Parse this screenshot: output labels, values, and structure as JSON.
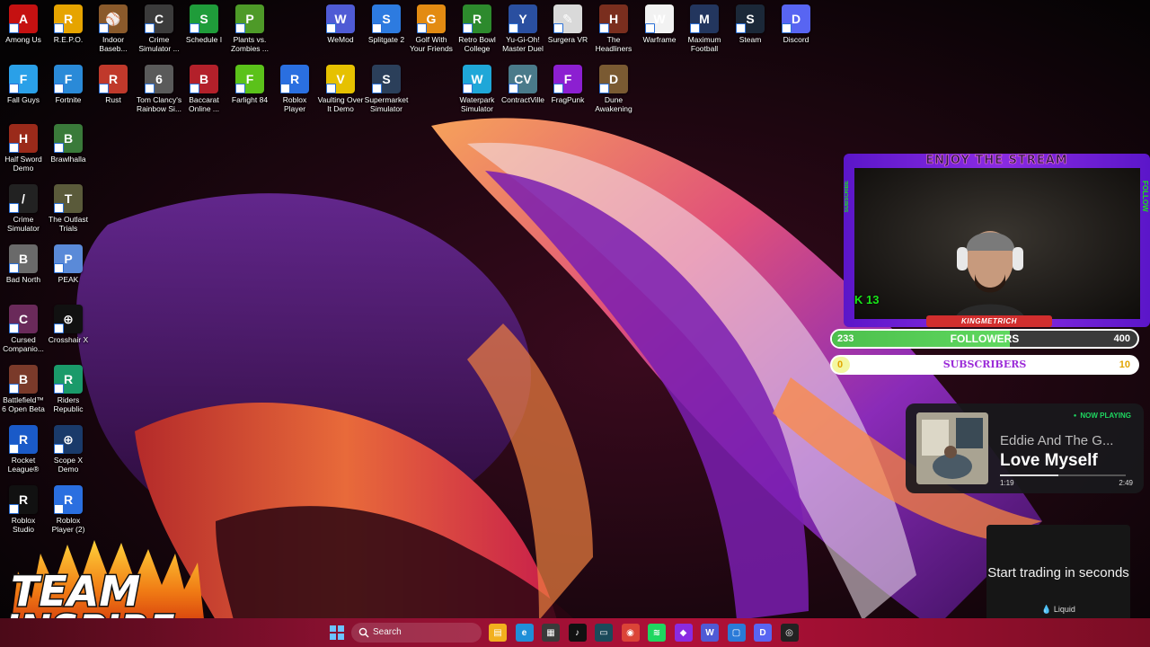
{
  "desktop": {
    "icons_top": [
      {
        "label": "Among Us",
        "icon": "among-us-icon",
        "color": "#c51111",
        "glyph": "A"
      },
      {
        "label": "R.E.P.O.",
        "icon": "repo-icon",
        "color": "#e6a400",
        "glyph": "R"
      },
      {
        "label": "Indoor Baseb...",
        "icon": "baseball-icon",
        "color": "#8a5a2b",
        "glyph": "⚾"
      },
      {
        "label": "Crime Simulator ...",
        "icon": "crime-sim-icon",
        "color": "#3b3b3b",
        "glyph": "C"
      },
      {
        "label": "Schedule I",
        "icon": "schedule-icon",
        "color": "#1f9c3a",
        "glyph": "S"
      },
      {
        "label": "Plants vs. Zombies ...",
        "icon": "pvz-icon",
        "color": "#4e9a28",
        "glyph": "P"
      },
      {
        "label": "WeMod",
        "icon": "wemod-icon",
        "color": "#4f5bd5",
        "glyph": "W"
      },
      {
        "label": "Splitgate 2",
        "icon": "splitgate-icon",
        "color": "#2d7be0",
        "glyph": "S"
      },
      {
        "label": "Golf With Your Friends",
        "icon": "golf-icon",
        "color": "#e38b12",
        "glyph": "G"
      },
      {
        "label": "Retro Bowl College",
        "icon": "retro-bowl-icon",
        "color": "#2d8a2d",
        "glyph": "R"
      },
      {
        "label": "Yu-Gi-Oh! Master Duel",
        "icon": "yugioh-icon",
        "color": "#2a4fa0",
        "glyph": "Y"
      },
      {
        "label": "Surgera VR",
        "icon": "surgeon-icon",
        "color": "#d9d9d9",
        "glyph": "✎"
      },
      {
        "label": "The Headliners",
        "icon": "headliners-icon",
        "color": "#7a2e1e",
        "glyph": "H"
      },
      {
        "label": "Warframe",
        "icon": "warframe-icon",
        "color": "#f2f2f2",
        "glyph": "W"
      },
      {
        "label": "Maximum Football",
        "icon": "football-icon",
        "color": "#23365e",
        "glyph": "M"
      },
      {
        "label": "Steam",
        "icon": "steam-icon",
        "color": "#1b2838",
        "glyph": "S"
      },
      {
        "label": "Discord",
        "icon": "discord-icon",
        "color": "#5865f2",
        "glyph": "D"
      }
    ],
    "icons_row2": [
      {
        "label": "Fall Guys",
        "icon": "fall-guys-icon",
        "color": "#2aa0e8",
        "glyph": "F"
      },
      {
        "label": "Fortnite",
        "icon": "fortnite-icon",
        "color": "#2a8ad8",
        "glyph": "F"
      },
      {
        "label": "Rust",
        "icon": "rust-icon",
        "color": "#c0392b",
        "glyph": "R"
      },
      {
        "label": "Tom Clancy's Rainbow Si...",
        "icon": "rainbow-six-icon",
        "color": "#5a5a5a",
        "glyph": "6"
      },
      {
        "label": "Baccarat Online ...",
        "icon": "baccarat-icon",
        "color": "#b3202a",
        "glyph": "B"
      },
      {
        "label": "Farlight 84",
        "icon": "farlight-icon",
        "color": "#5bc21a",
        "glyph": "F"
      },
      {
        "label": "Roblox Player",
        "icon": "roblox-icon",
        "color": "#2a6fe0",
        "glyph": "R"
      },
      {
        "label": "Vaulting Over It Demo",
        "icon": "vaulting-icon",
        "color": "#e6c100",
        "glyph": "V"
      },
      {
        "label": "Supermarket Simulator",
        "icon": "supermarket-icon",
        "color": "#2b3f5a",
        "glyph": "S"
      },
      {
        "label": "Waterpark Simulator",
        "icon": "waterpark-icon",
        "color": "#1fa7d8",
        "glyph": "W"
      },
      {
        "label": "ContractVille",
        "icon": "contractville-icon",
        "color": "#4a7a8a",
        "glyph": "CV"
      },
      {
        "label": "FragPunk",
        "icon": "fragpunk-icon",
        "color": "#8c1fd1",
        "glyph": "F"
      },
      {
        "label": "Dune Awakening",
        "icon": "dune-icon",
        "color": "#7a5a32",
        "glyph": "D"
      }
    ],
    "icons_left": [
      {
        "label": "Half Sword Demo",
        "icon": "half-sword-icon",
        "color": "#9a2a1a",
        "glyph": "H"
      },
      {
        "label": "Brawlhalla",
        "icon": "brawlhalla-icon",
        "color": "#3a7a3a",
        "glyph": "B"
      },
      {
        "label": "Crime Simulator",
        "icon": "crime-sim-2-icon",
        "color": "#222222",
        "glyph": "/"
      },
      {
        "label": "The Outlast Trials",
        "icon": "outlast-icon",
        "color": "#5a5a3a",
        "glyph": "T"
      },
      {
        "label": "Bad North",
        "icon": "bad-north-icon",
        "color": "#6a6a6a",
        "glyph": "B"
      },
      {
        "label": "PEAK",
        "icon": "peak-icon",
        "color": "#5a8ad8",
        "glyph": "P"
      },
      {
        "label": "Cursed Companio...",
        "icon": "cursed-icon",
        "color": "#6a2a5a",
        "glyph": "C"
      },
      {
        "label": "Crosshair X",
        "icon": "crosshair-icon",
        "color": "#111111",
        "glyph": "⊕"
      },
      {
        "label": "Battlefield™ 6 Open Beta",
        "icon": "battlefield-icon",
        "color": "#7a3a2a",
        "glyph": "B"
      },
      {
        "label": "Riders Republic",
        "icon": "riders-icon",
        "color": "#1a9a6a",
        "glyph": "R"
      },
      {
        "label": "Rocket League®",
        "icon": "rocket-league-icon",
        "color": "#1a5ac8",
        "glyph": "R"
      },
      {
        "label": "Scope X Demo",
        "icon": "scope-icon",
        "color": "#1a3a6a",
        "glyph": "⊕"
      },
      {
        "label": "Roblox Studio",
        "icon": "roblox-studio-icon",
        "color": "#111111",
        "glyph": "R"
      },
      {
        "label": "Roblox Player (2)",
        "icon": "roblox-2-icon",
        "color": "#2a6fe0",
        "glyph": "R"
      }
    ]
  },
  "cam": {
    "title": "ENJOY THE STREAM",
    "name": "KINGMETRICH",
    "k_label": "K 13",
    "side_left": "SUBSCRIBE",
    "side_right": "FOLLOW"
  },
  "goals": {
    "followers": {
      "current": "233",
      "label": "FOLLOWERS",
      "target": "400",
      "progress": 0.5825
    },
    "subscribers": {
      "current": "0",
      "label": "SUBSCRIBERS",
      "target": "10",
      "progress": 0.0
    }
  },
  "now_playing": {
    "status": "NOW PLAYING",
    "artist": "Eddie And The G...",
    "track": "Love Myself",
    "elapsed": "1:19",
    "duration": "2:49",
    "progress": 0.467
  },
  "ad": {
    "headline": "Start trading in seconds",
    "brand": "Liquid"
  },
  "logo": {
    "text": "TEAM INSPIRE"
  },
  "taskbar": {
    "search_label": "Search",
    "apps": [
      {
        "name": "file-explorer-icon",
        "color": "#f2b01e",
        "glyph": "▤"
      },
      {
        "name": "edge-icon",
        "color": "#1f8fd8",
        "glyph": "e"
      },
      {
        "name": "store-icon",
        "color": "#3a3a3a",
        "glyph": "▦"
      },
      {
        "name": "tiktok-icon",
        "color": "#111111",
        "glyph": "♪"
      },
      {
        "name": "terminal-icon",
        "color": "#1a4a5a",
        "glyph": "▭"
      },
      {
        "name": "chrome-icon",
        "color": "#db4437",
        "glyph": "◉"
      },
      {
        "name": "spotify-icon",
        "color": "#1ed760",
        "glyph": "≋"
      },
      {
        "name": "obs-icon",
        "color": "#8a2be2",
        "glyph": "◆"
      },
      {
        "name": "wemod-taskbar-icon",
        "color": "#4f5bd5",
        "glyph": "W"
      },
      {
        "name": "window-icon",
        "color": "#2a7ad8",
        "glyph": "▢"
      },
      {
        "name": "discord-taskbar-icon",
        "color": "#5865f2",
        "glyph": "D"
      },
      {
        "name": "github-icon",
        "color": "#222222",
        "glyph": "◎"
      }
    ]
  }
}
